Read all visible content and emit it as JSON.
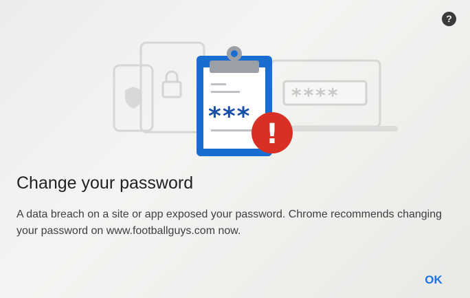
{
  "dialog": {
    "title": "Change your password",
    "message": "A data breach on a site or app exposed your password. Chrome recommends changing your password on www.footballguys.com now.",
    "ok_label": "OK",
    "help_glyph": "?"
  },
  "illustration": {
    "password_mask": "***",
    "field_mask": "****",
    "alert_glyph": "!",
    "icons": [
      "phone-icon",
      "shield-icon",
      "tablet-icon",
      "lock-icon",
      "laptop-icon",
      "clipboard-icon",
      "alert-icon"
    ]
  },
  "colors": {
    "accent": "#1a73e8",
    "clipboard_blue": "#1a6dd0",
    "alert_red": "#d93025",
    "text_primary": "#202124",
    "text_secondary": "#3c4043"
  }
}
